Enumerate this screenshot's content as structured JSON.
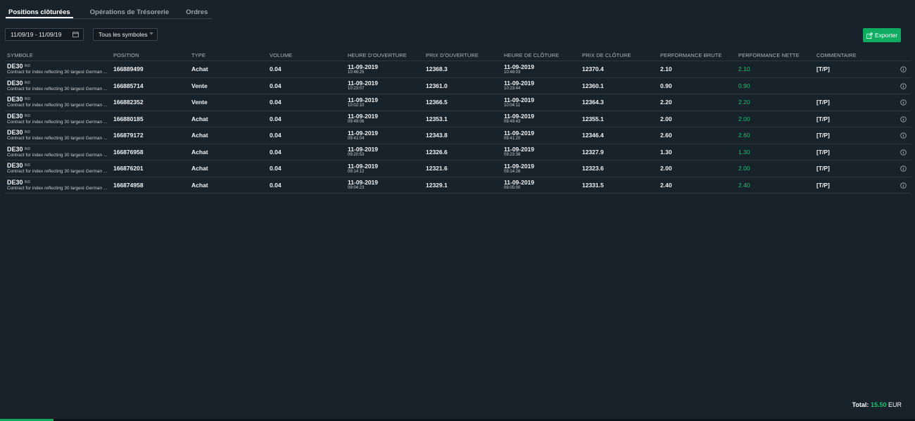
{
  "tabs": [
    {
      "label": "Positions clôturées",
      "active": true
    },
    {
      "label": "Opérations de Trésorerie",
      "active": false
    },
    {
      "label": "Ordres",
      "active": false
    }
  ],
  "filters": {
    "date_range": "11/09/19 - 11/09/19",
    "symbol": "Tous les symboles"
  },
  "export_label": "Exporter",
  "columns": [
    "SYMBOLE",
    "POSITION",
    "TYPE",
    "VOLUME",
    "HEURE D'OUVERTURE",
    "PRIX D'OUVERTURE",
    "HEURE DE CLÔTURE",
    "PRIX DE CLÔTURE",
    "PERFORMANCE BRUTE",
    "PERFORMANCE NETTE",
    "COMMENTAIRE"
  ],
  "rows": [
    {
      "symbol": "DE30",
      "badge": "IND",
      "desc": "Contract for index reflecting 30 largest German ...",
      "position": "166889499",
      "type": "Achat",
      "volume": "0.04",
      "open_date": "11-09-2019",
      "open_time": "10:46:25",
      "open_price": "12368.3",
      "close_date": "11-09-2019",
      "close_time": "10:48:03",
      "close_price": "12370.4",
      "gross": "2.10",
      "net": "2.10",
      "comment": "[T/P]"
    },
    {
      "symbol": "DE30",
      "badge": "IND",
      "desc": "Contract for index reflecting 30 largest German ...",
      "position": "166885714",
      "type": "Vente",
      "volume": "0.04",
      "open_date": "11-09-2019",
      "open_time": "10:23:07",
      "open_price": "12361.0",
      "close_date": "11-09-2019",
      "close_time": "10:23:44",
      "close_price": "12360.1",
      "gross": "0.90",
      "net": "0.90",
      "comment": ""
    },
    {
      "symbol": "DE30",
      "badge": "IND",
      "desc": "Contract for index reflecting 30 largest German ...",
      "position": "166882352",
      "type": "Vente",
      "volume": "0.04",
      "open_date": "11-09-2019",
      "open_time": "10:02:10",
      "open_price": "12366.5",
      "close_date": "11-09-2019",
      "close_time": "10:04:11",
      "close_price": "12364.3",
      "gross": "2.20",
      "net": "2.20",
      "comment": "[T/P]"
    },
    {
      "symbol": "DE30",
      "badge": "IND",
      "desc": "Contract for index reflecting 30 largest German ...",
      "position": "166880185",
      "type": "Achat",
      "volume": "0.04",
      "open_date": "11-09-2019",
      "open_time": "09:49:06",
      "open_price": "12353.1",
      "close_date": "11-09-2019",
      "close_time": "09:49:43",
      "close_price": "12355.1",
      "gross": "2.00",
      "net": "2.00",
      "comment": "[T/P]"
    },
    {
      "symbol": "DE30",
      "badge": "IND",
      "desc": "Contract for index reflecting 30 largest German ...",
      "position": "166879172",
      "type": "Achat",
      "volume": "0.04",
      "open_date": "11-09-2019",
      "open_time": "09:41:04",
      "open_price": "12343.8",
      "close_date": "11-09-2019",
      "close_time": "09:41:20",
      "close_price": "12346.4",
      "gross": "2.60",
      "net": "2.60",
      "comment": "[T/P]"
    },
    {
      "symbol": "DE30",
      "badge": "IND",
      "desc": "Contract for index reflecting 30 largest German ...",
      "position": "166876958",
      "type": "Achat",
      "volume": "0.04",
      "open_date": "11-09-2019",
      "open_time": "09:20:53",
      "open_price": "12326.6",
      "close_date": "11-09-2019",
      "close_time": "09:23:38",
      "close_price": "12327.9",
      "gross": "1.30",
      "net": "1.30",
      "comment": "[T/P]"
    },
    {
      "symbol": "DE30",
      "badge": "IND",
      "desc": "Contract for index reflecting 30 largest German ...",
      "position": "166876201",
      "type": "Achat",
      "volume": "0.04",
      "open_date": "11-09-2019",
      "open_time": "09:14:12",
      "open_price": "12321.6",
      "close_date": "11-09-2019",
      "close_time": "09:14:26",
      "close_price": "12323.6",
      "gross": "2.00",
      "net": "2.00",
      "comment": "[T/P]"
    },
    {
      "symbol": "DE30",
      "badge": "IND",
      "desc": "Contract for index reflecting 30 largest German ...",
      "position": "166874958",
      "type": "Achat",
      "volume": "0.04",
      "open_date": "11-09-2019",
      "open_time": "09:04:23",
      "open_price": "12329.1",
      "close_date": "11-09-2019",
      "close_time": "09:05:00",
      "close_price": "12331.5",
      "gross": "2.40",
      "net": "2.40",
      "comment": "[T/P]"
    }
  ],
  "total": {
    "label": "Total:",
    "value": "15.50",
    "currency": "EUR"
  },
  "colors": {
    "accent": "#0eab61",
    "positive": "#1cc26f",
    "background": "#18222a"
  },
  "icons": {
    "calendar": "calendar-icon",
    "chevron": "chevron-down-icon",
    "export": "export-icon",
    "info": "info-icon"
  }
}
